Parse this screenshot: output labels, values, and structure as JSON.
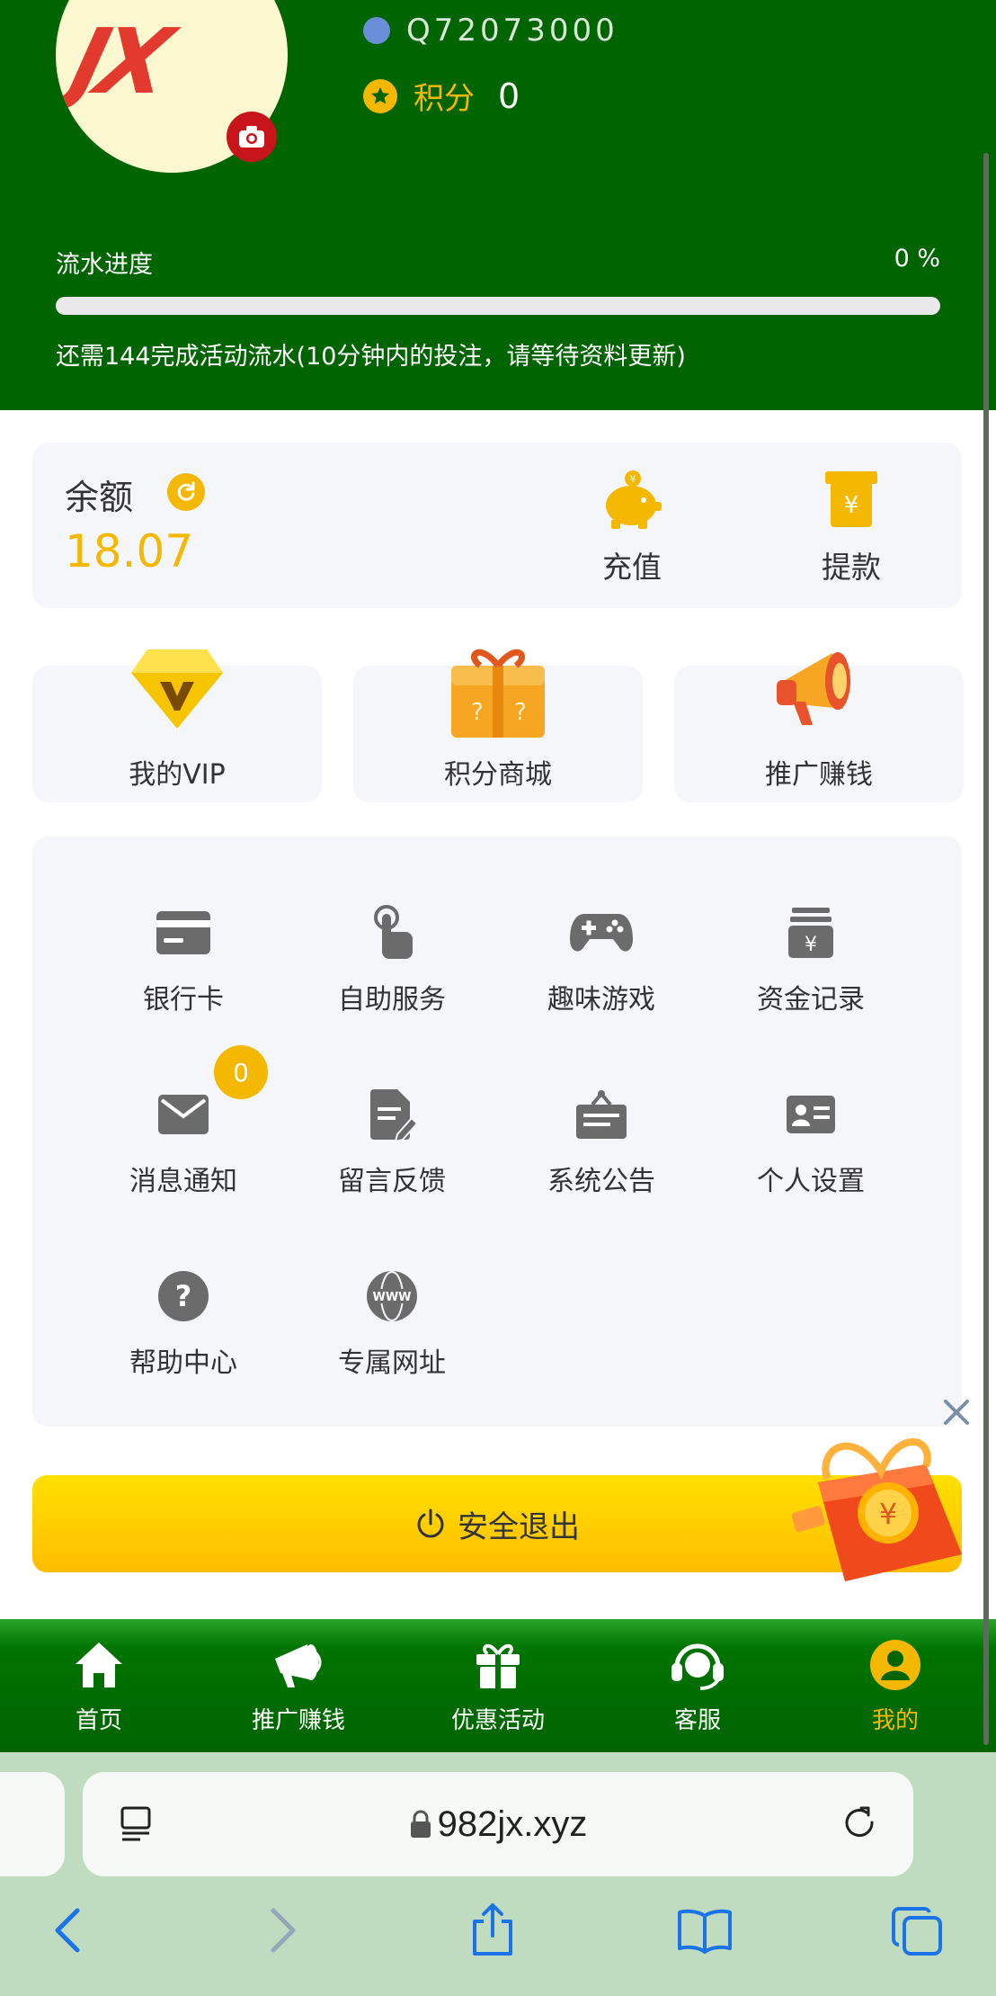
{
  "profile": {
    "id_partial": "Q72073000",
    "points_label": "积分",
    "points_value": "0"
  },
  "turnover": {
    "title": "流水进度",
    "percent_text": "0 %",
    "progress_fraction": 0,
    "note": "还需144完成活动流水(10分钟内的投注，请等待资料更新)"
  },
  "balance": {
    "label": "余额",
    "value": "18.07",
    "deposit_label": "充值",
    "withdraw_label": "提款"
  },
  "features": [
    {
      "label": "我的VIP",
      "icon": "diamond-icon"
    },
    {
      "label": "积分商城",
      "icon": "gift-box-icon"
    },
    {
      "label": "推广赚钱",
      "icon": "megaphone-icon"
    }
  ],
  "menu": [
    {
      "label": "银行卡",
      "icon": "bank-card-icon"
    },
    {
      "label": "自助服务",
      "icon": "touch-icon"
    },
    {
      "label": "趣味游戏",
      "icon": "gamepad-icon"
    },
    {
      "label": "资金记录",
      "icon": "funds-record-icon"
    },
    {
      "label": "消息通知",
      "icon": "mail-icon",
      "badge": "0"
    },
    {
      "label": "留言反馈",
      "icon": "feedback-icon"
    },
    {
      "label": "系统公告",
      "icon": "announcement-icon"
    },
    {
      "label": "个人设置",
      "icon": "id-card-icon"
    },
    {
      "label": "帮助中心",
      "icon": "help-icon"
    },
    {
      "label": "专属网址",
      "icon": "www-icon"
    }
  ],
  "logout_label": "安全退出",
  "tabs": [
    {
      "label": "首页",
      "icon": "home-icon"
    },
    {
      "label": "推广赚钱",
      "icon": "megaphone-icon"
    },
    {
      "label": "优惠活动",
      "icon": "gift-icon"
    },
    {
      "label": "客服",
      "icon": "headset-icon"
    },
    {
      "label": "我的",
      "icon": "user-icon",
      "active": true
    }
  ],
  "browser": {
    "url": "982jx.xyz"
  },
  "colors": {
    "header_green": "#006400",
    "accent_gold": "#f5b800",
    "card_bg": "#f5f6fa",
    "browser_bg": "#c0dcc0"
  }
}
